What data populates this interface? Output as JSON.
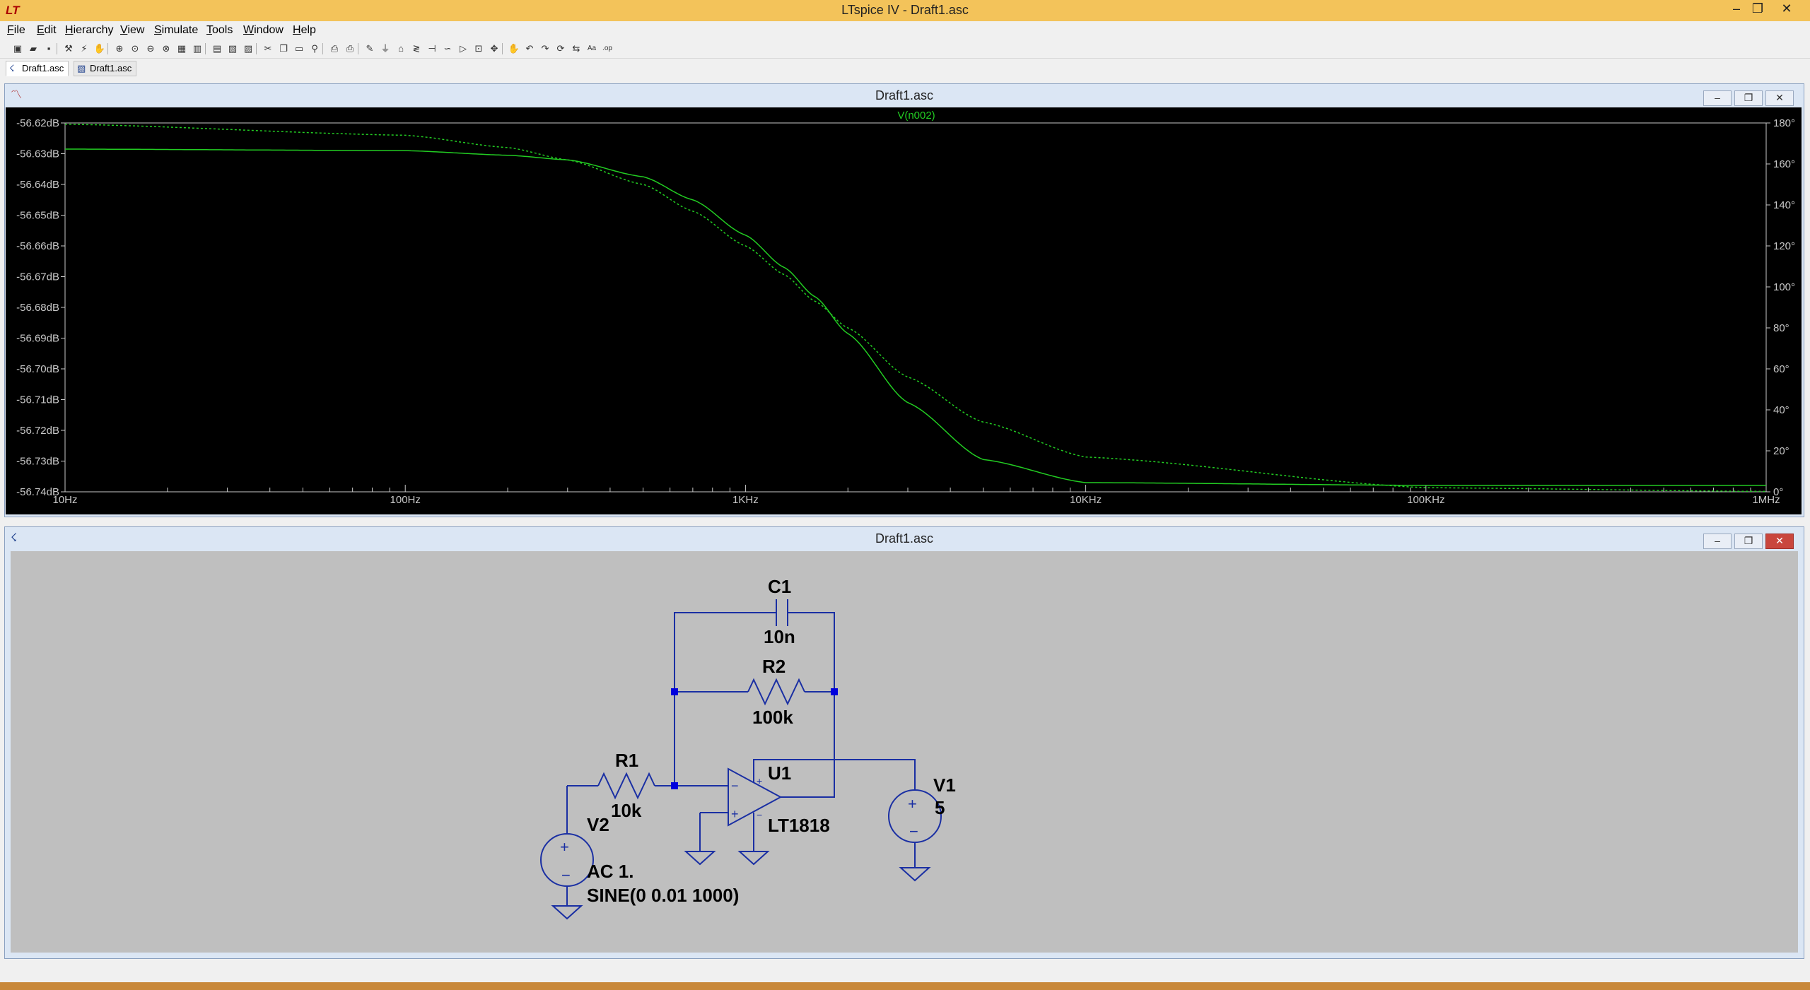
{
  "app": {
    "title": "LTspice IV - Draft1.asc",
    "icon": "ltspice-logo-icon",
    "icon_glyph": "LT"
  },
  "window_buttons": {
    "minimize": "–",
    "maximize": "❐",
    "close": "✕"
  },
  "menu": [
    {
      "label": "File",
      "u": "F",
      "rest": "ile"
    },
    {
      "label": "Edit",
      "u": "E",
      "rest": "dit"
    },
    {
      "label": "Hierarchy",
      "u": "H",
      "rest": "ierarchy"
    },
    {
      "label": "View",
      "u": "V",
      "rest": "iew"
    },
    {
      "label": "Simulate",
      "u": "S",
      "rest": "imulate"
    },
    {
      "label": "Tools",
      "u": "T",
      "rest": "ools"
    },
    {
      "label": "Window",
      "u": "W",
      "rest": "indow"
    },
    {
      "label": "Help",
      "u": "H",
      "rest": "elp"
    }
  ],
  "toolbar": [
    {
      "name": "new-schematic-icon",
      "g": "▣"
    },
    {
      "name": "open-icon",
      "g": "▰"
    },
    {
      "name": "save-icon",
      "g": "▪"
    },
    {
      "name": "control-panel-icon",
      "g": "⚒"
    },
    {
      "name": "run-icon",
      "g": "⚡"
    },
    {
      "name": "halt-icon",
      "g": "✋"
    },
    {
      "name": "zoom-in-icon",
      "g": "⊕"
    },
    {
      "name": "pan-icon",
      "g": "⊙"
    },
    {
      "name": "zoom-out-icon",
      "g": "⊖"
    },
    {
      "name": "zoom-fit-icon",
      "g": "⊗"
    },
    {
      "name": "autorange-icon",
      "g": "▦"
    },
    {
      "name": "grid-icon",
      "g": "▥"
    },
    {
      "name": "tile-horizontal-icon",
      "g": "▤"
    },
    {
      "name": "cascade-icon",
      "g": "▧"
    },
    {
      "name": "tile-vertical-icon",
      "g": "▨"
    },
    {
      "name": "cut-icon",
      "g": "✂"
    },
    {
      "name": "copy-icon",
      "g": "❐"
    },
    {
      "name": "paste-icon",
      "g": "▭"
    },
    {
      "name": "find-icon",
      "g": "⚲"
    },
    {
      "name": "print-preview-icon",
      "g": "⎙"
    },
    {
      "name": "print-icon",
      "g": "⎙"
    },
    {
      "name": "wire-icon",
      "g": "✎"
    },
    {
      "name": "ground-icon",
      "g": "⏚"
    },
    {
      "name": "label-net-icon",
      "g": "⌂"
    },
    {
      "name": "resistor-icon",
      "g": "≷"
    },
    {
      "name": "capacitor-icon",
      "g": "⊣"
    },
    {
      "name": "inductor-icon",
      "g": "∽"
    },
    {
      "name": "diode-icon",
      "g": "▷"
    },
    {
      "name": "component-icon",
      "g": "⊡"
    },
    {
      "name": "move-icon",
      "g": "✥"
    },
    {
      "name": "drag-icon",
      "g": "✋"
    },
    {
      "name": "undo-icon",
      "g": "↶"
    },
    {
      "name": "redo-icon",
      "g": "↷"
    },
    {
      "name": "rotate-icon",
      "g": "⟳"
    },
    {
      "name": "mirror-icon",
      "g": "⇆"
    },
    {
      "name": "text-icon",
      "g": "Aa"
    },
    {
      "name": "spice-directive-icon",
      "g": ".op"
    }
  ],
  "tabs": [
    {
      "label": "Draft1.asc",
      "icon": "waveform-tab-icon",
      "glyph": "☇",
      "active": true
    },
    {
      "label": "Draft1.asc",
      "icon": "schematic-tab-icon",
      "glyph": "▧",
      "active": false
    }
  ],
  "plot_window": {
    "title": "Draft1.asc",
    "icon": "waveform-icon",
    "trace_label": "V(n002)",
    "colors": {
      "bg": "#000000",
      "trace": "#22cc22",
      "axis": "#c8c8c8",
      "grid": "#4a4a4a"
    }
  },
  "chart_data": {
    "type": "line",
    "title": "",
    "xlabel": "",
    "ylabel": "",
    "x_scale": "log",
    "xlim": [
      10,
      1000000
    ],
    "ylim": [
      -56.74,
      -56.62
    ],
    "y2lim": [
      0,
      180
    ],
    "x_tick_labels": [
      "10Hz",
      "100Hz",
      "1KHz",
      "10KHz",
      "100KHz",
      "1MHz"
    ],
    "y_tick_labels": [
      "-56.62dB",
      "-56.63dB",
      "-56.64dB",
      "-56.65dB",
      "-56.66dB",
      "-56.67dB",
      "-56.68dB",
      "-56.69dB",
      "-56.70dB",
      "-56.71dB",
      "-56.72dB",
      "-56.73dB",
      "-56.74dB"
    ],
    "y2_tick_labels": [
      "180°",
      "160°",
      "140°",
      "120°",
      "100°",
      "80°",
      "60°",
      "40°",
      "20°",
      "0°"
    ],
    "series": [
      {
        "name": "V(n002)",
        "quantity": "magnitude",
        "axis": "left",
        "style": "solid",
        "x": [
          10,
          100,
          200,
          300,
          500,
          700,
          1000,
          1300,
          1600,
          2000,
          3000,
          5000,
          10000,
          100000,
          1000000
        ],
        "y": [
          -56.6285,
          -56.629,
          -56.6305,
          -56.632,
          -56.6375,
          -56.645,
          -56.6565,
          -56.667,
          -56.6765,
          -56.6885,
          -56.711,
          -56.7295,
          -56.737,
          -56.7379,
          -56.7379
        ]
      },
      {
        "name": "V(n002)",
        "quantity": "phase",
        "axis": "right",
        "style": "dotted",
        "x": [
          10,
          100,
          200,
          300,
          500,
          700,
          1000,
          1300,
          1600,
          2000,
          3000,
          5000,
          10000,
          100000,
          1000000
        ],
        "y": [
          179.4,
          174,
          168,
          162,
          150,
          137,
          120,
          106,
          93,
          80,
          56,
          34,
          17,
          2,
          0.2
        ]
      }
    ]
  },
  "schematic_window": {
    "title": "Draft1.asc",
    "icon": "schematic-icon",
    "colors": {
      "bg": "#bfbfbf",
      "wire": "#1a2fa3",
      "junction": "#0000dd",
      "label": "#000000"
    },
    "labels": {
      "c1_name": "C1",
      "c1_value": "10n",
      "r2_name": "R2",
      "r2_value": "100k",
      "r1_name": "R1",
      "r1_value": "10k",
      "u1_name": "U1",
      "u1_value": "LT1818",
      "v1_name": "V1",
      "v1_value": "5",
      "v2_name": "V2",
      "v2_ac": "AC 1.",
      "v2_sine": "SINE(0 0.01 1000)"
    }
  }
}
